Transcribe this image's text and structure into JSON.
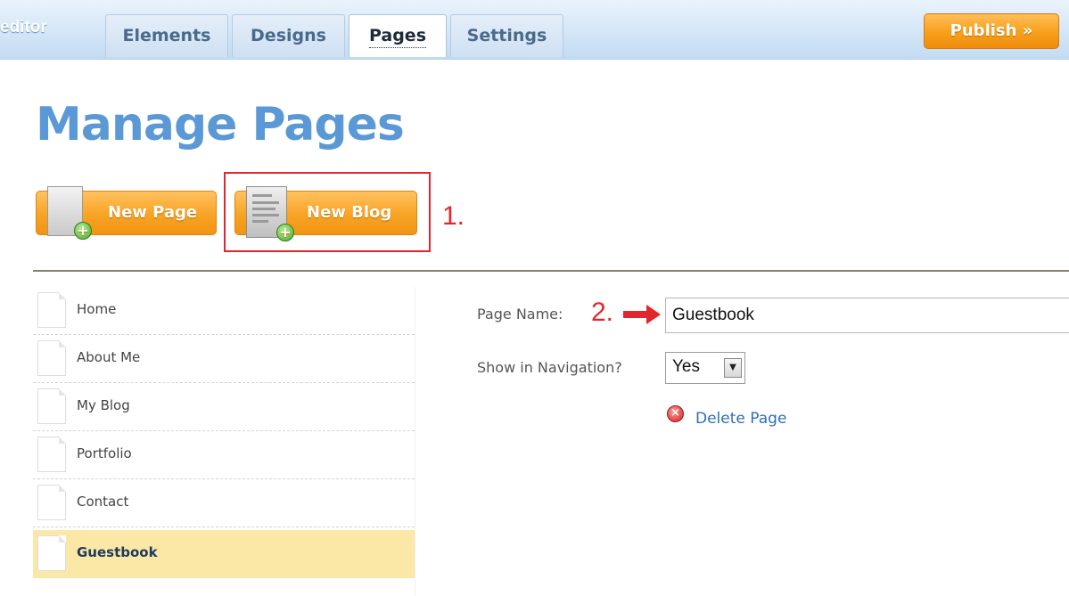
{
  "app": {
    "brand": "editor",
    "tabs": [
      {
        "label": "Elements"
      },
      {
        "label": "Designs"
      },
      {
        "label": "Pages"
      },
      {
        "label": "Settings"
      }
    ],
    "active_tab": "Pages",
    "publish_label": "Publish »"
  },
  "page": {
    "title": "Manage Pages"
  },
  "actions": {
    "new_page_label": "New Page",
    "new_blog_label": "New Blog",
    "annotation_1": "1.",
    "annotation_2": "2."
  },
  "pages_list": [
    {
      "name": "Home"
    },
    {
      "name": "About Me"
    },
    {
      "name": "My Blog"
    },
    {
      "name": "Portfolio"
    },
    {
      "name": "Contact"
    },
    {
      "name": "Guestbook"
    }
  ],
  "selected_page": "Guestbook",
  "form": {
    "page_name_label": "Page Name:",
    "page_name_value": "Guestbook",
    "show_nav_label": "Show in Navigation?",
    "show_nav_value": "Yes",
    "delete_label": "Delete Page"
  },
  "colors": {
    "accent_orange": "#f7a21e",
    "title_blue": "#5b98d6",
    "annotation_red": "#e3262b",
    "selected_row": "#fbe8a6"
  }
}
